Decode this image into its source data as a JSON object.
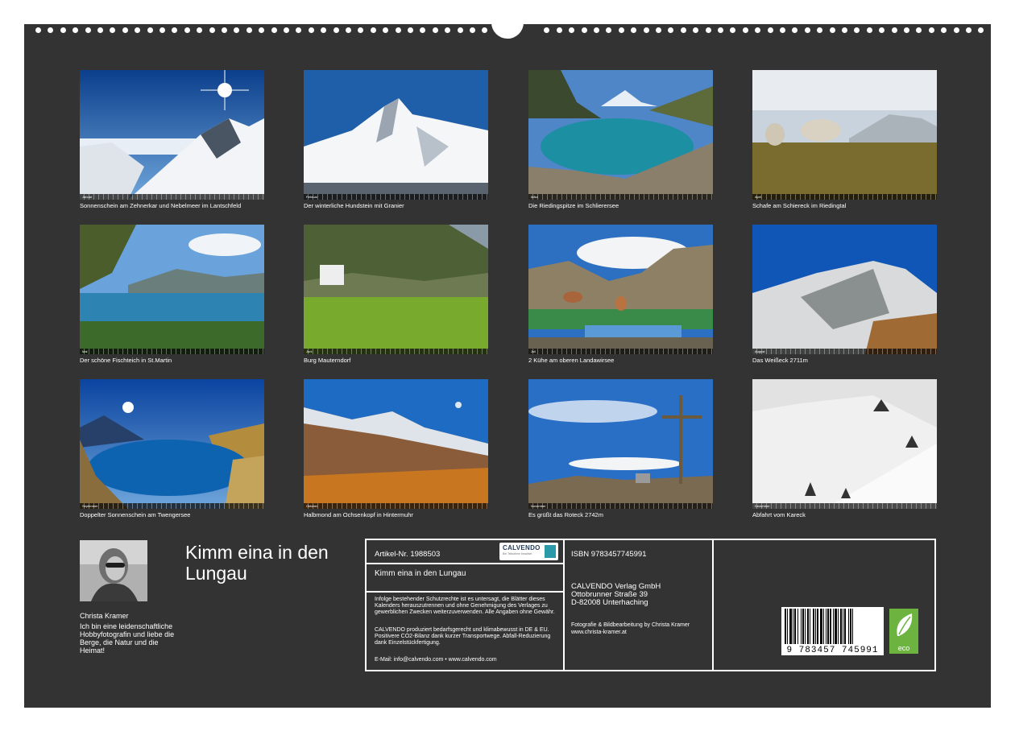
{
  "months": [
    {
      "month_label": "Januar",
      "caption": "Sonnenschein am Zehnerkar und Nebelmeer im Lantschfeld"
    },
    {
      "month_label": "Februar",
      "caption": "Der winterliche Hundstein mit Granier"
    },
    {
      "month_label": "März",
      "caption": "Die Riedingspitze im Schlierersee"
    },
    {
      "month_label": "April",
      "caption": "Schafe am Schiereck im Riedingtal"
    },
    {
      "month_label": "Mai",
      "caption": "Der schöne Fischteich in St.Martin"
    },
    {
      "month_label": "Juni",
      "caption": "Burg Mauterndorf"
    },
    {
      "month_label": "Juli",
      "caption": "2 Kühe am oberen Landawirsee"
    },
    {
      "month_label": "August",
      "caption": "Das Weißeck 2711m"
    },
    {
      "month_label": "September",
      "caption": "Doppelter Sonnenschein am Twengersee"
    },
    {
      "month_label": "Oktober",
      "caption": "Halbmond am Ochsenkopf in Hintermuhr"
    },
    {
      "month_label": "November",
      "caption": "Es grüßt das Roteck 2742m"
    },
    {
      "month_label": "Dezember",
      "caption": "Abfahrt vom Kareck"
    }
  ],
  "author": {
    "name": "Christa Kramer",
    "bio": "Ich bin eine leidenschaftliche Hobbyfotografin und liebe die Berge, die Natur und die Heimat!"
  },
  "title": "Kimm eina in den Lungau",
  "info": {
    "article_no": "Artikel-Nr. 1988503",
    "logo_text": "CALVENDO",
    "logo_sub": "Bei Teilnahme beachtet",
    "subtitle": "Kimm eina in den Lungau",
    "legal_text": "Infolge bestehender Schutzrechte ist es untersagt, die Blätter dieses Kalenders herauszutrennen und ohne Genehmigung des Verlages zu gewerblichen Zwecken weiterzuverwenden. Alle Angaben ohne Gewähr.",
    "eco_text": "CALVENDO produziert bedarfsgerecht und klimabewusst in DE & EU. Positivere CO2-Bilanz dank kurzer Transportwege. Abfall-Reduzierung dank Einzelstückfertigung.",
    "contact": "E-Mail: info@calvendo.com • www.calvendo.com",
    "isbn": "ISBN 9783457745991",
    "publisher_name": "CALVENDO Verlag GmbH",
    "publisher_street": "Ottobrunner Straße 39",
    "publisher_city": "D-82008 Unterhaching",
    "credits": "Fotografie & Bildbearbeitung by Christa Kramer www.christa-kramer.at",
    "barcode_digits": "9 783457 745991",
    "eco_label": "eco"
  }
}
